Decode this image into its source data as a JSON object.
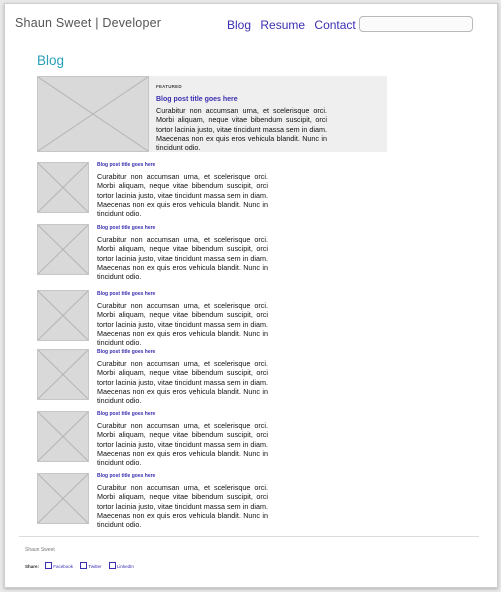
{
  "header": {
    "logo": "Shaun Sweet | Developer",
    "nav": [
      "Blog",
      "Resume",
      "Contact"
    ],
    "search_placeholder": ""
  },
  "main": {
    "heading": "Blog",
    "featured": {
      "tag": "FEATURED",
      "title": "Blog post title goes here",
      "body": "Curabitur non accumsan urna, et scelerisque orci. Morbi aliquam, neque vitae bibendum suscipit, orci tortor lacinia justo, vitae tincidunt massa sem in diam. Maecenas non ex quis eros vehicula blandit. Nunc in tincidunt odio."
    },
    "posts": [
      {
        "title": "Blog post title goes here",
        "body": "Curabitur non accumsan urna, et scelerisque orci. Morbi aliquam, neque vitae bibendum suscipit, orci tortor lacinia justo, vitae tincidunt massa sem in diam. Maecenas non ex quis eros vehicula blandit. Nunc in tincidunt odio."
      },
      {
        "title": "Blog post title goes here",
        "body": "Curabitur non accumsan urna, et scelerisque orci. Morbi aliquam, neque vitae bibendum suscipit, orci tortor lacinia justo, vitae tincidunt massa sem in diam. Maecenas non ex quis eros vehicula blandit. Nunc in tincidunt odio."
      },
      {
        "title": "Blog post title goes here",
        "body": "Curabitur non accumsan urna, et scelerisque orci. Morbi aliquam, neque vitae bibendum suscipit, orci tortor lacinia justo, vitae tincidunt massa sem in diam. Maecenas non ex quis eros vehicula blandit. Nunc in tincidunt odio."
      },
      {
        "title": "Blog post title goes here",
        "body": "Curabitur non accumsan urna, et scelerisque orci. Morbi aliquam, neque vitae bibendum suscipit, orci tortor lacinia justo, vitae tincidunt massa sem in diam. Maecenas non ex quis eros vehicula blandit. Nunc in tincidunt odio."
      },
      {
        "title": "Blog post title goes here",
        "body": "Curabitur non accumsan urna, et scelerisque orci. Morbi aliquam, neque vitae bibendum suscipit, orci tortor lacinia justo, vitae tincidunt massa sem in diam. Maecenas non ex quis eros vehicula blandit. Nunc in tincidunt odio."
      },
      {
        "title": "Blog post title goes here",
        "body": "Curabitur non accumsan urna, et scelerisque orci. Morbi aliquam, neque vitae bibendum suscipit, orci tortor lacinia justo, vitae tincidunt massa sem in diam. Maecenas non ex quis eros vehicula blandit. Nunc in tincidunt odio."
      }
    ]
  },
  "footer": {
    "name": "Shaun Sweet",
    "share_label": "Share:",
    "share_links": [
      {
        "label": "Facebook",
        "icon": "facebook-icon"
      },
      {
        "label": "Twitter",
        "icon": "twitter-icon"
      },
      {
        "label": "LinkedIn",
        "icon": "linkedin-icon"
      }
    ]
  },
  "colors": {
    "accent": "#2aa0b8",
    "link": "#3a2fb0",
    "placeholder": "#d9d9d9"
  }
}
